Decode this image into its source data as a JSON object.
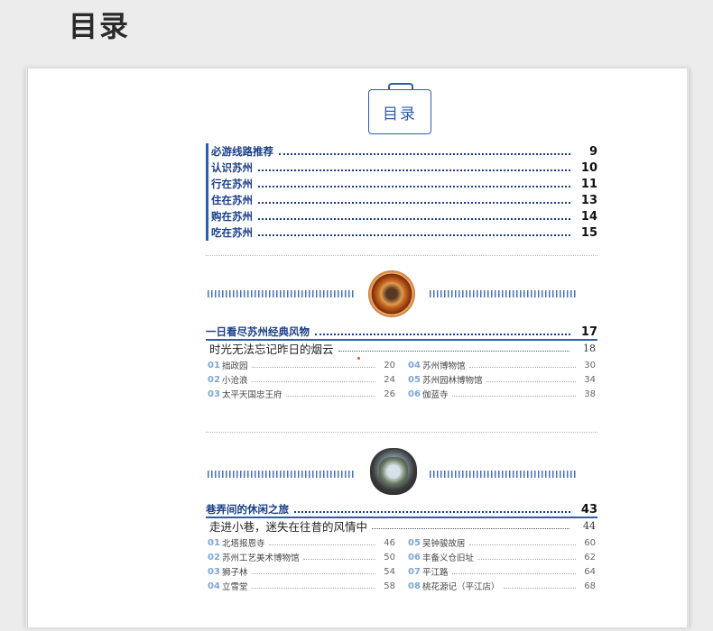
{
  "heading": "目录",
  "badge": "目录",
  "toc": [
    {
      "label": "必游线路推荐",
      "page": "9"
    },
    {
      "label": "认识苏州",
      "page": "10"
    },
    {
      "label": "行在苏州",
      "page": "11"
    },
    {
      "label": "住在苏州",
      "page": "13"
    },
    {
      "label": "购在苏州",
      "page": "14"
    },
    {
      "label": "吃在苏州",
      "page": "15"
    }
  ],
  "sections": [
    {
      "title": "一日看尽苏州经典风物",
      "page": "17",
      "subtitle": "时光无法忘记昨日的烟云",
      "subpage": "18",
      "left": [
        {
          "num": "01",
          "name": "拙政园",
          "page": "20"
        },
        {
          "num": "02",
          "name": "小沧浪",
          "page": "24"
        },
        {
          "num": "03",
          "name": "太平天国忠王府",
          "page": "26"
        }
      ],
      "right": [
        {
          "num": "04",
          "name": "苏州博物馆",
          "page": "30"
        },
        {
          "num": "05",
          "name": "苏州园林博物馆",
          "page": "34"
        },
        {
          "num": "06",
          "name": "伽蓝寺",
          "page": "38"
        }
      ]
    },
    {
      "title": "巷弄间的休闲之旅",
      "page": "43",
      "subtitle": "走进小巷，迷失在往昔的风情中",
      "subpage": "44",
      "left": [
        {
          "num": "01",
          "name": "北塔报恩寺",
          "page": "46"
        },
        {
          "num": "02",
          "name": "苏州工艺美术博物馆",
          "page": "50"
        },
        {
          "num": "03",
          "name": "狮子林",
          "page": "54"
        },
        {
          "num": "04",
          "name": "立雪堂",
          "page": "58"
        }
      ],
      "right": [
        {
          "num": "05",
          "name": "吴钟骏故居",
          "page": "60"
        },
        {
          "num": "06",
          "name": "丰备义仓旧址",
          "page": "62"
        },
        {
          "num": "07",
          "name": "平江路",
          "page": "64"
        },
        {
          "num": "08",
          "name": "桃花源记（平江店）",
          "page": "68"
        }
      ]
    }
  ]
}
